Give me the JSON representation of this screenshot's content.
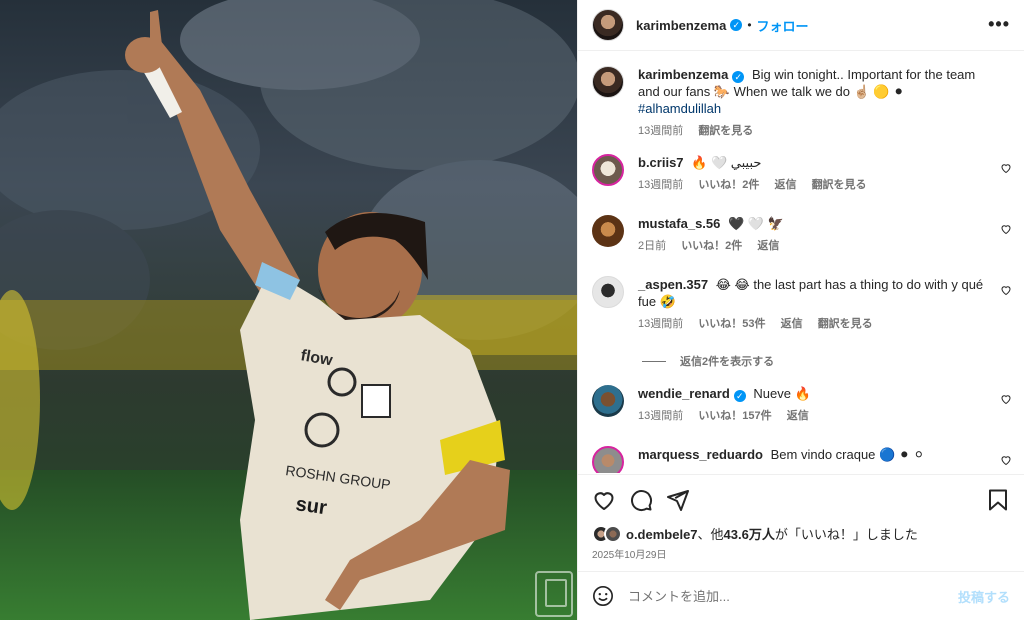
{
  "post": {
    "author": "karimbenzema",
    "follow_label": "フォロー",
    "separator": "•",
    "more_label": "•••"
  },
  "caption": {
    "user": "karimbenzema",
    "text": "Big win tonight.. Important for the team and our fans 🐎 When we talk we do ☝🏼 🟡 ⚫",
    "hashtag": "#alhamdulillah",
    "time": "13週間前",
    "translate": "翻訳を見る"
  },
  "comments": [
    {
      "user": "b.criis7",
      "text": "🔥 🤍 حبيبي",
      "time": "13週間前",
      "likes": "いいね！2件",
      "reply": "返信",
      "translate": "翻訳を見る",
      "has_story": true
    },
    {
      "user": "mustafa_s.56",
      "text": "🖤 🤍 🦅",
      "time": "2日前",
      "likes": "いいね！2件",
      "reply": "返信",
      "translate": "",
      "has_story": false
    },
    {
      "user": "_aspen.357",
      "text": "😂 😂 the last part has a thing to do with y qué fue 🤣",
      "time": "13週間前",
      "likes": "いいね！53件",
      "reply": "返信",
      "translate": "翻訳を見る",
      "has_story": false
    },
    {
      "user": "wendie_renard",
      "text": "Nueve 🔥",
      "time": "13週間前",
      "likes": "いいね！157件",
      "reply": "返信",
      "translate": "",
      "verified": true,
      "has_story": false
    },
    {
      "user": "marquess_reduardo",
      "text": "Bem vindo craque 🔵 ⚫ ⚪",
      "time": "",
      "likes": "",
      "reply": "",
      "translate": "",
      "has_story": true
    }
  ],
  "view_replies": "返信2件を表示する",
  "likes_summary": {
    "user": "o.dembele7",
    "mid": "、他",
    "count": "43.6万人",
    "suffix": "が「いいね！」しました"
  },
  "post_date": "2025年10月29日",
  "comment_input": {
    "placeholder": "コメントを追加...",
    "post_label": "投稿する"
  },
  "icons": {
    "like": "heart-icon",
    "comment": "comment-icon",
    "share": "send-icon",
    "save": "bookmark-icon",
    "emoji": "emoji-icon",
    "more": "more-icon"
  },
  "colors": {
    "accent": "#0095f6",
    "link": "#00376b",
    "muted": "#737373",
    "verified": "#0095f6"
  }
}
